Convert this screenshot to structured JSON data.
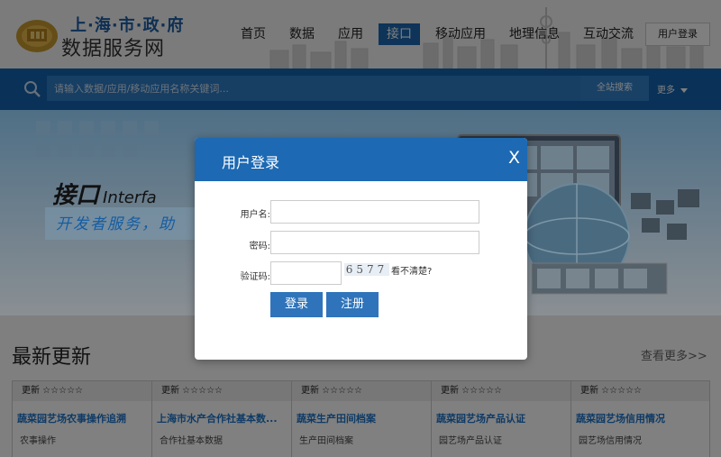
{
  "header": {
    "logo_top": "上·海·市·政·府",
    "logo_bottom": "数据服务网",
    "login_label": "用户登录"
  },
  "nav": [
    {
      "label": "首页"
    },
    {
      "label": "数据"
    },
    {
      "label": "应用"
    },
    {
      "label": "接口"
    },
    {
      "label": "移动应用"
    },
    {
      "label": "地理信息"
    },
    {
      "label": "互动交流"
    }
  ],
  "search": {
    "placeholder": "请输入数据/应用/移动应用名称关键词...",
    "button_label": "全站搜索",
    "more_label": "更多"
  },
  "banner": {
    "title": "接口",
    "title_en": "Interfa",
    "subtitle": "开发者服务，助"
  },
  "latest": {
    "title": "最新更新",
    "view_more": "查看更多>>",
    "cards": [
      {
        "head": "更新 ☆☆☆☆☆",
        "title": "蔬菜园艺场农事操作追溯",
        "desc": "农事操作"
      },
      {
        "head": "更新 ☆☆☆☆☆",
        "title": "上海市水产合作社基本数...",
        "desc": "合作社基本数据"
      },
      {
        "head": "更新 ☆☆☆☆☆",
        "title": "蔬菜生产田间档案",
        "desc": "生产田间档案"
      },
      {
        "head": "更新 ☆☆☆☆☆",
        "title": "蔬菜园艺场产品认证",
        "desc": "园艺场产品认证"
      },
      {
        "head": "更新 ☆☆☆☆☆",
        "title": "蔬菜园艺场信用情况",
        "desc": "园艺场信用情况"
      }
    ]
  },
  "modal": {
    "title": "用户登录",
    "close": "X",
    "username_label": "用户名:",
    "password_label": "密码:",
    "captcha_label": "验证码:",
    "captcha_text": "6577",
    "captcha_hint": "看不清楚?",
    "login_button": "登录",
    "register_button": "注册"
  },
  "colors": {
    "primary": "#1d69b3",
    "search_bar": "#1464b0",
    "overlay": "rgba(0,0,0,0.5)"
  }
}
